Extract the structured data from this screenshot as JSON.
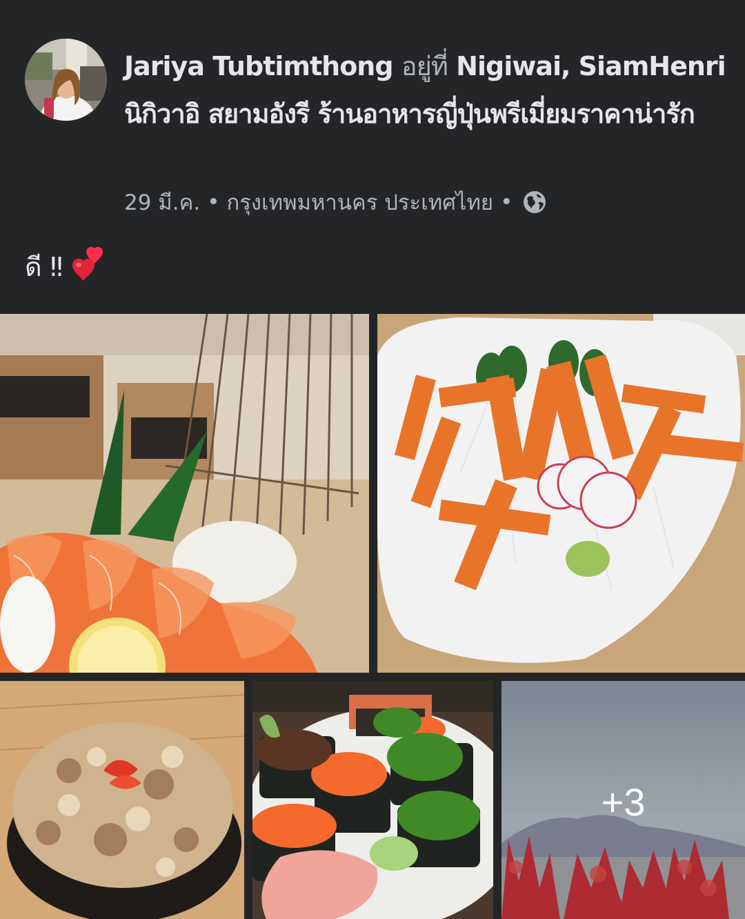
{
  "post": {
    "author": "Jariya Tubtimthong",
    "at_word": "อยู่ที่",
    "place": "Nigiwai, SiamHenri นิกิวาอิ สยามอังรี ร้านอาหารญี่ปุ่นพรีเมี่ยมราคาน่ารัก",
    "date": "29 มี.ค.",
    "separator": "•",
    "location": "กรุงเทพมหานคร ประเทศไทย",
    "privacy_icon": "globe-icon",
    "caption": "ดี ‼",
    "caption_emoji": "two-hearts-icon"
  },
  "photos": {
    "count": 5,
    "more_label": "+3",
    "items": [
      {
        "name": "salmon-sashimi-photo"
      },
      {
        "name": "crab-stick-sashimi-photo"
      },
      {
        "name": "okonomiyaki-photo"
      },
      {
        "name": "gunkan-sushi-photo"
      },
      {
        "name": "more-photos-thumbnail"
      }
    ]
  },
  "colors": {
    "background": "#242526",
    "primary_text": "#e4e6eb",
    "secondary_text": "#b0b3b8",
    "heart_red": "#e0243a"
  }
}
